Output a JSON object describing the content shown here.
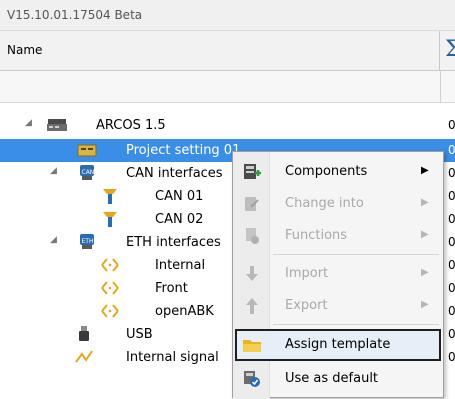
{
  "window": {
    "title": "V15.10.01.17504 Beta"
  },
  "grid": {
    "name_header": "Name",
    "sum_icon": "sigma-icon"
  },
  "tree": {
    "rows": [
      {
        "label": "ARCOS 1.5",
        "value": "0",
        "icon": "server-icon"
      },
      {
        "label": "Project setting 01",
        "value": "0",
        "icon": "project-settings-icon"
      },
      {
        "label": "CAN interfaces",
        "value": "0",
        "icon": "can-icon"
      },
      {
        "label": "CAN 01",
        "value": "0",
        "icon": "can-connector-icon"
      },
      {
        "label": "CAN 02",
        "value": "0",
        "icon": "can-connector-icon"
      },
      {
        "label": "ETH interfaces",
        "value": "0",
        "icon": "eth-icon"
      },
      {
        "label": "Internal",
        "value": "0",
        "icon": "bidirectional-arrow-icon"
      },
      {
        "label": "Front",
        "value": "0",
        "icon": "bidirectional-arrow-icon"
      },
      {
        "label": "openABK",
        "value": "0",
        "icon": "bidirectional-arrow-icon"
      },
      {
        "label": "USB",
        "value": "0",
        "icon": "usb-icon"
      },
      {
        "label": "Internal signal",
        "value": "0",
        "icon": "signal-icon"
      }
    ]
  },
  "context_menu": {
    "items": [
      {
        "label": "Components",
        "icon": "components-icon",
        "enabled": true,
        "submenu": true
      },
      {
        "label": "Change into",
        "icon": "change-into-icon",
        "enabled": false,
        "submenu": true
      },
      {
        "label": "Functions",
        "icon": "functions-icon",
        "enabled": false,
        "submenu": true
      },
      {
        "label": "Import",
        "icon": "import-icon",
        "enabled": false,
        "submenu": true
      },
      {
        "label": "Export",
        "icon": "export-icon",
        "enabled": false,
        "submenu": true
      },
      {
        "label": "Assign template",
        "icon": "folder-icon",
        "enabled": true,
        "submenu": false,
        "highlighted": true
      },
      {
        "label": "Use as default",
        "icon": "default-icon",
        "enabled": true,
        "submenu": false
      }
    ]
  },
  "colors": {
    "selection": "#3a8ee6",
    "accent": "#2a5f9e"
  }
}
